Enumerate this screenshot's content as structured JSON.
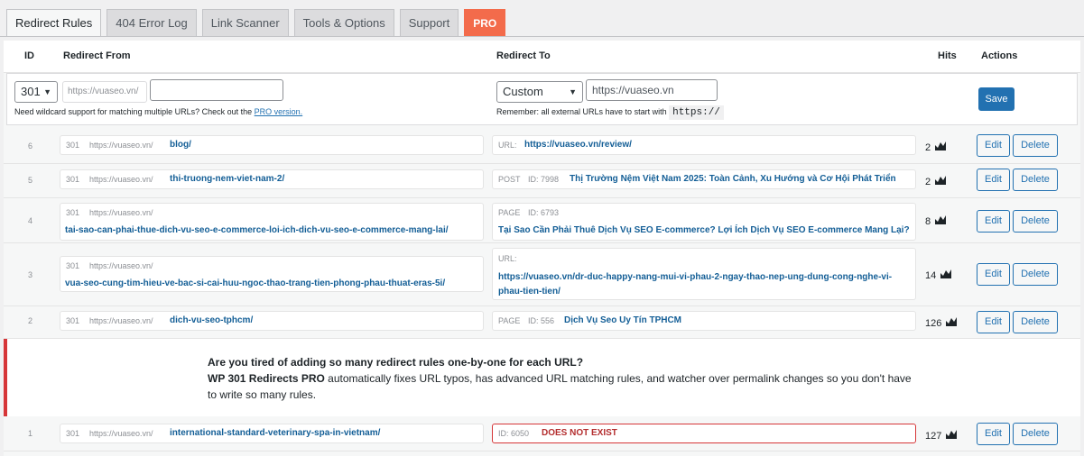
{
  "tabs": [
    {
      "label": "Redirect Rules"
    },
    {
      "label": "404 Error Log"
    },
    {
      "label": "Link Scanner"
    },
    {
      "label": "Tools & Options"
    },
    {
      "label": "Support"
    },
    {
      "label": "PRO"
    }
  ],
  "table": {
    "headers": {
      "id": "ID",
      "from": "Redirect From",
      "to": "Redirect To",
      "hits": "Hits",
      "actions": "Actions"
    }
  },
  "new_rule": {
    "status_code": "301",
    "from_prefix": "https://vuaseo.vn/",
    "from_value": "",
    "to_type": "Custom",
    "to_value": "https://vuaseo.vn",
    "wildcard_hint": "Need wildcard support for matching multiple URLs? Check out the",
    "wildcard_link": "PRO version.",
    "external_hint": "Remember: all external URLs have to start with",
    "external_code": "https://",
    "save_label": "Save"
  },
  "rows": [
    {
      "id": "6",
      "code": "301",
      "prefix": "https://vuaseo.vn/",
      "from": "blog/",
      "to_type": "URL:",
      "to_id": "",
      "to": "https://vuaseo.vn/review/",
      "to2": "",
      "hits": "2"
    },
    {
      "id": "5",
      "code": "301",
      "prefix": "https://vuaseo.vn/",
      "from": "thi-truong-nem-viet-nam-2/",
      "to_type": "POST",
      "to_id": "ID: 7998",
      "to": "Thị Trường Nệm Việt Nam 2025: Toàn Cảnh, Xu Hướng và Cơ Hội Phát Triển",
      "to2": "",
      "hits": "2"
    },
    {
      "id": "4",
      "code": "301",
      "prefix": "https://vuaseo.vn/",
      "from": "tai-sao-can-phai-thue-dich-vu-seo-e-commerce-loi-ich-dich-vu-seo-e-commerce-mang-lai/",
      "to_type": "PAGE",
      "to_id": "ID: 6793",
      "to": "Tại Sao Cần Phải Thuê Dịch Vụ SEO E-commerce? Lợi Ích Dịch Vụ SEO E-commerce Mang Lại?",
      "to2": "",
      "hits": "8"
    },
    {
      "id": "3",
      "code": "301",
      "prefix": "https://vuaseo.vn/",
      "from": "vua-seo-cung-tim-hieu-ve-bac-si-cai-huu-ngoc-thao-trang-tien-phong-phau-thuat-eras-5i/",
      "to_type": "URL:",
      "to_id": "",
      "to": "https://vuaseo.vn/dr-duc-happy-nang-mui-vi-phau-2-ngay-thao-nep-ung-dung-cong-nghe-vi-",
      "to2": "phau-tien-tien/",
      "hits": "14"
    },
    {
      "id": "2",
      "code": "301",
      "prefix": "https://vuaseo.vn/",
      "from": "dich-vu-seo-tphcm/",
      "to_type": "PAGE",
      "to_id": "ID: 556",
      "to": "Dịch Vụ Seo Uy Tín TPHCM",
      "to2": "",
      "hits": "126"
    },
    {
      "id": "1",
      "code": "301",
      "prefix": "https://vuaseo.vn/",
      "from": "international-standard-veterinary-spa-in-vietnam/",
      "to_type": "",
      "to_id": "ID: 6050",
      "to": "DOES NOT EXIST",
      "to2": "",
      "hits": "127"
    }
  ],
  "actions": {
    "edit": "Edit",
    "delete": "Delete"
  },
  "promo": {
    "line1": "Are you tired of adding so many redirect rules one-by-one for each URL?",
    "brand": "WP 301 Redirects PRO",
    "line2": " automatically fixes URL typos, has advanced URL matching rules, and watcher over permalink changes so you don't have",
    "line3": "to write so many rules."
  },
  "colors": {
    "accent": "#2271b1",
    "pro": "#f36b4b",
    "error": "#d63638",
    "link": "#135e96"
  },
  "icons": {
    "hits": "chart-icon",
    "dropdown": "chevron-down-icon"
  }
}
